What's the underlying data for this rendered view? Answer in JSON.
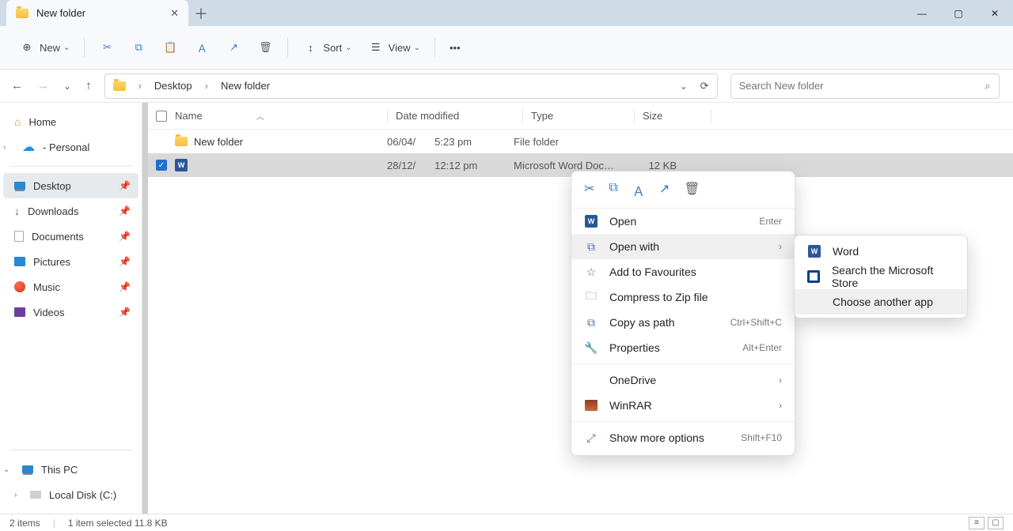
{
  "tab": {
    "title": "New folder"
  },
  "toolbar": {
    "new": "New",
    "sort": "Sort",
    "view": "View"
  },
  "breadcrumb": {
    "root": "Desktop",
    "current": "New folder"
  },
  "search": {
    "placeholder": "Search New folder"
  },
  "sidebar": {
    "home": "Home",
    "personal": "- Personal",
    "desktop": "Desktop",
    "downloads": "Downloads",
    "documents": "Documents",
    "pictures": "Pictures",
    "music": "Music",
    "videos": "Videos",
    "thispc": "This PC",
    "localdisk": "Local Disk (C:)"
  },
  "columns": {
    "name": "Name",
    "date": "Date modified",
    "type": "Type",
    "size": "Size"
  },
  "rows": [
    {
      "name": "New folder",
      "date": "06/04/",
      "time": "5:23 pm",
      "type": "File folder",
      "size": ""
    },
    {
      "name": "",
      "date": "28/12/",
      "time": "12:12 pm",
      "type": "Microsoft Word Doc…",
      "size": "12 KB"
    }
  ],
  "context": {
    "open": "Open",
    "open_sc": "Enter",
    "openwith": "Open with",
    "fav": "Add to Favourites",
    "zip": "Compress to Zip file",
    "copypath": "Copy as path",
    "copypath_sc": "Ctrl+Shift+C",
    "props": "Properties",
    "props_sc": "Alt+Enter",
    "onedrive": "OneDrive",
    "winrar": "WinRAR",
    "more": "Show more options",
    "more_sc": "Shift+F10"
  },
  "submenu": {
    "word": "Word",
    "store": "Search the Microsoft Store",
    "choose": "Choose another app"
  },
  "status": {
    "items": "2 items",
    "selected": "1 item selected  11.8 KB"
  }
}
